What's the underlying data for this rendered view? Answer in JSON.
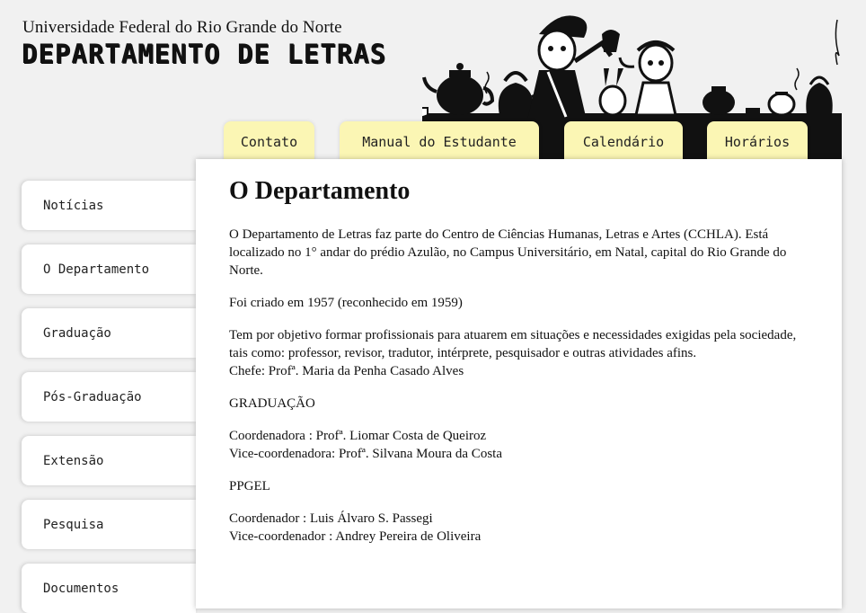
{
  "header": {
    "university": "Universidade Federal do Rio Grande do Norte",
    "department": "DEPARTAMENTO DE LETRAS"
  },
  "tabs": [
    {
      "label": "Contato"
    },
    {
      "label": "Manual do Estudante"
    },
    {
      "label": "Calendário"
    },
    {
      "label": "Horários"
    }
  ],
  "sidebar": {
    "items": [
      {
        "label": "Notícias"
      },
      {
        "label": "O Departamento"
      },
      {
        "label": "Graduação"
      },
      {
        "label": "Pós-Graduação"
      },
      {
        "label": "Extensão"
      },
      {
        "label": "Pesquisa"
      },
      {
        "label": "Documentos"
      }
    ]
  },
  "main": {
    "title": "O Departamento",
    "p1": "O Departamento de Letras faz parte do Centro de Ciências Humanas, Letras e Artes (CCHLA). Está localizado no 1° andar do prédio Azulão, no Campus Universitário, em Natal, capital do Rio Grande do Norte.",
    "p2": "Foi criado em 1957 (reconhecido em 1959)",
    "p3_line1": "Tem por objetivo formar profissionais para atuarem em situações e necessidades exigidas pela sociedade, tais como: professor, revisor, tradutor, intérprete, pesquisador e outras atividades afins.",
    "p3_line2": "Chefe: Profª. Maria da Penha Casado Alves",
    "graduacao_heading": "GRADUAÇÃO",
    "grad_coord": "Coordenadora : Profª. Liomar Costa de Queiroz",
    "grad_vice": "Vice-coordenadora: Profª. Silvana Moura da Costa",
    "ppgel_heading": "PPGEL",
    "ppgel_coord": "Coordenador : Luis Álvaro S. Passegi",
    "ppgel_vice": "Vice-coordenador : Andrey Pereira de Oliveira"
  },
  "colors": {
    "tab_bg": "#fbf6b4",
    "page_bg": "#f1f1f1",
    "panel_bg": "#ffffff"
  }
}
